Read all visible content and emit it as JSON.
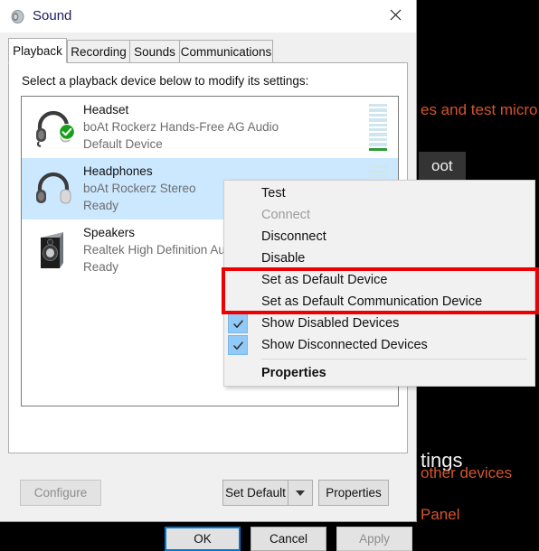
{
  "background": {
    "line_microphones": "es and test micro",
    "button_troubleshoot": "oot",
    "heading_settings": "tings",
    "line_other_devices": "other devices",
    "line_panel": "Panel",
    "text_color": "#d4552a",
    "heading_color": "#f2f2f2"
  },
  "dialog": {
    "title": "Sound",
    "title_icon": "speaker-icon",
    "close_label": "✕",
    "tabs": [
      {
        "label": "Playback",
        "active": true
      },
      {
        "label": "Recording",
        "active": false
      },
      {
        "label": "Sounds",
        "active": false
      },
      {
        "label": "Communications",
        "active": false
      }
    ],
    "pane_instruction": "Select a playback device below to modify its settings:",
    "devices": [
      {
        "name": "Headset",
        "description": "boAt Rockerz Hands-Free AG Audio",
        "state": "Default Device",
        "icon": "headset-icon",
        "badge": "green-check-badge",
        "selected": false,
        "meter_segments": 10,
        "meter_active": 1
      },
      {
        "name": "Headphones",
        "description": "boAt Rockerz Stereo",
        "state": "Ready",
        "icon": "headphones-icon",
        "badge": "",
        "selected": true,
        "meter_segments": 10,
        "meter_active": 0
      },
      {
        "name": "Speakers",
        "description": "Realtek High Definition Audio",
        "state": "Ready",
        "icon": "speaker-box-icon",
        "badge": "",
        "selected": false,
        "meter_segments": 0,
        "meter_active": 0
      }
    ],
    "buttons": {
      "configure": "Configure",
      "set_default": "Set Default",
      "set_default_arrow": "chevron-down-icon",
      "properties": "Properties",
      "ok": "OK",
      "cancel": "Cancel",
      "apply": "Apply"
    }
  },
  "context_menu": {
    "items": [
      {
        "label": "Test",
        "disabled": false,
        "checked": false,
        "bold": false
      },
      {
        "label": "Connect",
        "disabled": true,
        "checked": false,
        "bold": false
      },
      {
        "label": "Disconnect",
        "disabled": false,
        "checked": false,
        "bold": false
      },
      {
        "label": "Disable",
        "disabled": false,
        "checked": false,
        "bold": false
      },
      {
        "label": "Set as Default Device",
        "disabled": false,
        "checked": false,
        "bold": false
      },
      {
        "label": "Set as Default Communication Device",
        "disabled": false,
        "checked": false,
        "bold": false
      },
      {
        "label": "Show Disabled Devices",
        "disabled": false,
        "checked": true,
        "bold": false
      },
      {
        "label": "Show Disconnected Devices",
        "disabled": false,
        "checked": true,
        "bold": false
      },
      {
        "label": "Properties",
        "disabled": false,
        "checked": false,
        "bold": true
      }
    ],
    "highlight_color": "#ee0000"
  }
}
